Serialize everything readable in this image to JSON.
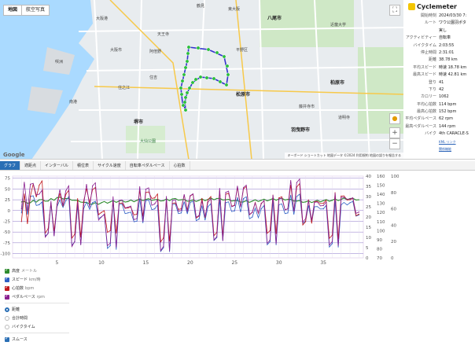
{
  "map": {
    "type_buttons": [
      "地図",
      "航空写真"
    ],
    "labels": {
      "yao": "八尾市",
      "kyoto_bay": "南港",
      "osaka_port": "大阪港",
      "kashiwara": "柏原市",
      "matsubara": "松原市",
      "fujiidera": "藤井寺市",
      "habikino": "羽曳野市",
      "sakai": "堺市",
      "higashiosaka": "東大阪",
      "abeno": "阿倍野",
      "sumiyoshi": "住吉",
      "hiranoku": "平野区",
      "tennoji": "天王寺",
      "tsurumi": "鶴見",
      "sakishima": "咲洲",
      "suminoe": "住之江",
      "daisen": "大仙公園",
      "usp": "大阪市",
      "kinki": "近畿大学",
      "tojo": "道明寺"
    },
    "footer": "キーボード ショートカット  地図データ ©2024  利用規約  地図の誤りを報告する",
    "google": "Google",
    "route_color": "#3333cc",
    "marker_color": "#2bbf3c"
  },
  "info": {
    "brand": "Cyclemeter",
    "rows": [
      {
        "label": "開始時刻",
        "value": "2024/03/30 7:"
      },
      {
        "label": "ルート",
        "value": "ワウ公園羽ポタ "
      },
      {
        "label": "",
        "value": "実し"
      },
      {
        "label": "アクティビティー",
        "value": "自転車"
      },
      {
        "label": "バイクタイム",
        "value": "2:03:55"
      },
      {
        "label": "停止時間",
        "value": "2:31:01"
      },
      {
        "label": "距離",
        "value": "38.78 km"
      },
      {
        "label": "平均スピード",
        "value": "時速 18.78 km"
      },
      {
        "label": "最高スピード",
        "value": "時速 42.81 km"
      },
      {
        "label": "登り",
        "value": "41"
      },
      {
        "label": "下り",
        "value": "42"
      },
      {
        "label": "カロリー",
        "value": "1062"
      },
      {
        "label": "平均心拍数",
        "value": "114 bpm"
      },
      {
        "label": "最高心拍数",
        "value": "152 bpm"
      },
      {
        "label": "平均ペダルペース",
        "value": "62 rpm"
      },
      {
        "label": "最高ペダルペース",
        "value": "144 rpm"
      },
      {
        "label": "バイク",
        "value": "4th CARACLE-S"
      }
    ],
    "kml_link": "KML リンク",
    "sub_link": "関係機能"
  },
  "tabs": [
    "グラフ",
    "適距点",
    "インターバル",
    "積位表",
    "サイクル速度",
    "自転車ペダルペース",
    "心拍数"
  ],
  "chart_data": {
    "type": "line",
    "x": [
      1,
      2,
      3,
      4,
      5,
      6,
      7,
      8,
      9,
      10,
      11,
      12,
      13,
      14,
      15,
      16,
      17,
      18,
      19,
      20,
      21,
      22,
      23,
      24,
      25,
      26,
      27,
      28,
      29,
      30,
      31,
      32,
      33,
      34,
      35,
      36,
      37,
      38,
      39
    ],
    "x_ticks": [
      5,
      10,
      15,
      20,
      25,
      30,
      35
    ],
    "xlim": [
      0,
      39.5
    ],
    "y_left_ticks": [
      75,
      50,
      25,
      0,
      -25,
      -50,
      -75,
      -100
    ],
    "y_left_lim": [
      -110,
      80
    ],
    "y2_ticks": [
      40,
      35,
      30,
      25,
      20,
      15,
      10,
      5,
      0
    ],
    "y2_lim": [
      0,
      40
    ],
    "y3_ticks": [
      160,
      150,
      140,
      130,
      120,
      110,
      100,
      90,
      80,
      70
    ],
    "y3_lim": [
      70,
      160
    ],
    "y4_ticks": [
      100,
      80,
      60,
      40,
      20,
      0
    ],
    "y4_lim": [
      0,
      100
    ],
    "series": [
      {
        "name": "高度",
        "color": "#2e8b2e",
        "axis": "left",
        "values": [
          20,
          18,
          25,
          22,
          30,
          28,
          24,
          19,
          15,
          18,
          20,
          22,
          21,
          24,
          26,
          25,
          23,
          27,
          25,
          22,
          24,
          26,
          28,
          25,
          23,
          20,
          22,
          24,
          25,
          27,
          26,
          22,
          20,
          21,
          23,
          24,
          26,
          28,
          25
        ]
      },
      {
        "name": "スピード",
        "color": "#2d5fc4",
        "axis": "y2",
        "values": [
          22,
          30,
          26,
          12,
          25,
          28,
          8,
          24,
          27,
          20,
          6,
          26,
          22,
          18,
          28,
          24,
          5,
          26,
          22,
          27,
          19,
          25,
          10,
          27,
          23,
          29,
          20,
          24,
          8,
          26,
          22,
          30,
          18,
          25,
          24,
          7,
          26,
          27,
          21
        ]
      },
      {
        "name": "心拍数",
        "color": "#c0181c",
        "axis": "y3",
        "values": [
          110,
          138,
          150,
          102,
          128,
          140,
          96,
          132,
          145,
          120,
          100,
          130,
          125,
          118,
          142,
          136,
          92,
          130,
          124,
          138,
          116,
          134,
          98,
          140,
          128,
          146,
          120,
          130,
          100,
          136,
          124,
          148,
          110,
          132,
          130,
          95,
          138,
          134,
          118
        ]
      },
      {
        "name": "ペダルペース",
        "color": "#8a1f8f",
        "axis": "y4",
        "values": [
          60,
          90,
          78,
          30,
          66,
          82,
          20,
          64,
          88,
          50,
          18,
          70,
          62,
          48,
          84,
          66,
          14,
          70,
          58,
          76,
          52,
          68,
          26,
          80,
          64,
          86,
          56,
          66,
          22,
          72,
          60,
          92,
          48,
          68,
          64,
          20,
          74,
          72,
          56
        ]
      }
    ]
  },
  "legend": {
    "items": [
      {
        "label": "高度",
        "unit": "メートル",
        "color": "#2e8b2e"
      },
      {
        "label": "スピード",
        "unit": "km/時",
        "color": "#2d5fc4"
      },
      {
        "label": "心拍数",
        "unit": "bpm",
        "color": "#c0181c"
      },
      {
        "label": "ペダルペース",
        "unit": "rpm",
        "color": "#8a1f8f"
      }
    ],
    "x_options": [
      "距離",
      "合計時間",
      "バイクタイム"
    ],
    "smooth_label": "スムース"
  }
}
